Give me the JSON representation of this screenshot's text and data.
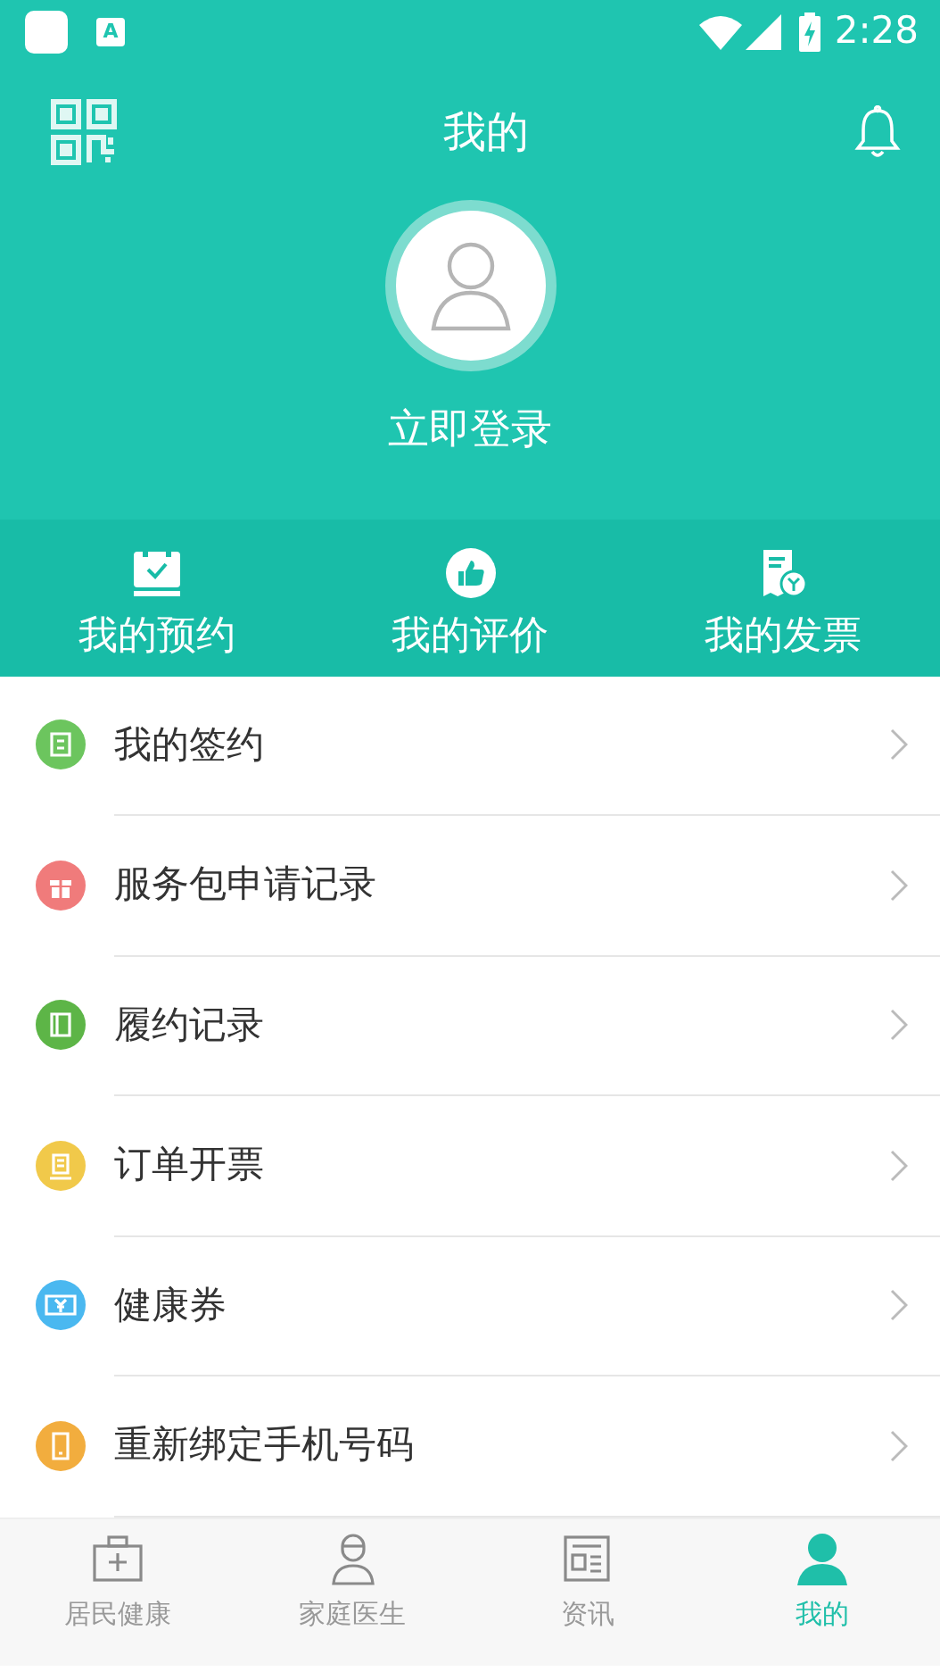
{
  "status_bar": {
    "notification": "A",
    "time": "2:28"
  },
  "header": {
    "title": "我的"
  },
  "profile": {
    "login": "立即登录"
  },
  "quick_actions": [
    {
      "label": "我的预约"
    },
    {
      "label": "我的评价"
    },
    {
      "label": "我的发票"
    }
  ],
  "menu": [
    {
      "label": "我的签约",
      "color": "#6cc55e"
    },
    {
      "label": "服务包申请记录",
      "color": "#f07b7b"
    },
    {
      "label": "履约记录",
      "color": "#5db547"
    },
    {
      "label": "订单开票",
      "color": "#f1c94a"
    },
    {
      "label": "健康券",
      "color": "#4ab8f0"
    },
    {
      "label": "重新绑定手机号码",
      "color": "#f2ad3e"
    }
  ],
  "tab_bar": [
    {
      "label": "居民健康",
      "selected": false
    },
    {
      "label": "家庭医生",
      "selected": false
    },
    {
      "label": "资讯",
      "selected": false
    },
    {
      "label": "我的",
      "selected": true
    }
  ]
}
